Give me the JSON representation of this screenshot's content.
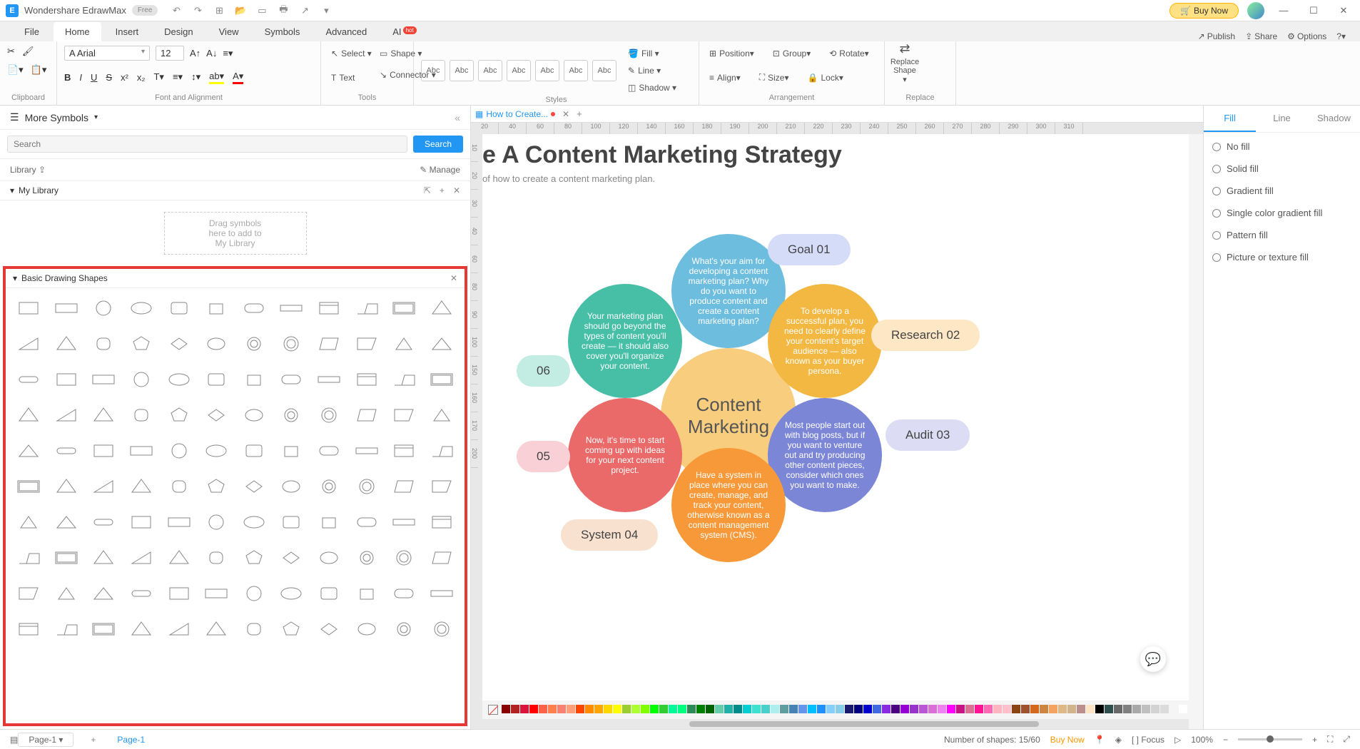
{
  "app": {
    "name": "Wondershare EdrawMax",
    "badge": "Free"
  },
  "buy_now": "Buy Now",
  "menu": {
    "file": "File",
    "home": "Home",
    "insert": "Insert",
    "design": "Design",
    "view": "View",
    "symbols": "Symbols",
    "advanced": "Advanced",
    "ai": "AI",
    "hot": "hot",
    "publish": "Publish",
    "share": "Share",
    "options": "Options"
  },
  "ribbon": {
    "clipboard": "Clipboard",
    "font_align": "Font and Alignment",
    "tools": "Tools",
    "styles": "Styles",
    "arrangement": "Arrangement",
    "replace_g": "Replace",
    "font_name": "Arial",
    "font_size": "12",
    "select_btn": "Select ▾",
    "text_btn": "Text",
    "shape_btn": "Shape ▾",
    "connector_btn": "Connector ▾",
    "fill": "Fill ▾",
    "line": "Line ▾",
    "shadow": "Shadow ▾",
    "position": "Position▾",
    "align": "Align▾",
    "group": "Group▾",
    "size": "Size▾",
    "rotate": "Rotate▾",
    "lock": "Lock▾",
    "replace_shape": "Replace\nShape ▾",
    "abc": "Abc"
  },
  "left": {
    "more_symbols": "More Symbols",
    "search_ph": "Search",
    "search_btn": "Search",
    "library": "Library",
    "manage": "Manage",
    "my_library": "My Library",
    "drag_hint": "Drag symbols\nhere to add to\nMy Library",
    "basic_shapes": "Basic Drawing Shapes"
  },
  "doc": {
    "tab1": "How to Create...",
    "title_frag": "e A Content Marketing Strategy",
    "subtitle": "of how to create a content marketing plan.",
    "center": "Content Marketing",
    "b1": "What's your aim for developing a content marketing plan? Why do you want to produce content and create a content marketing plan?",
    "b2": "To develop a successful plan, you need to clearly define your content's target audience — also known as your buyer persona.",
    "b3": "Most people start out with blog posts, but if you want to venture out and try producing other content pieces, consider which ones you want to make.",
    "b4": "Have a system in place where you can create, manage, and track your content, otherwise known as a content management system (CMS).",
    "b5": "Now, it's time to start coming up with ideas for your next content project.",
    "b6": "Your marketing plan should go beyond the types of content you'll create — it should also cover you'll organize your content.",
    "l1": "Goal 01",
    "l2": "Research 02",
    "l3": "Audit 03",
    "l4": "System 04",
    "l5": "05",
    "l6": "06"
  },
  "right_panel": {
    "fill_tab": "Fill",
    "line_tab": "Line",
    "shadow_tab": "Shadow",
    "no_fill": "No fill",
    "solid": "Solid fill",
    "gradient": "Gradient fill",
    "single_grad": "Single color gradient fill",
    "pattern": "Pattern fill",
    "picture": "Picture or texture fill"
  },
  "status": {
    "page_sel": "Page-1",
    "active_page": "Page-1",
    "shapes": "Number of shapes: 15/60",
    "buy": "Buy Now",
    "focus": "Focus",
    "zoom": "100%"
  },
  "ruler_marks": [
    "20",
    "40",
    "60",
    "80",
    "100",
    "120",
    "140",
    "160",
    "180",
    "190",
    "200",
    "210",
    "220",
    "230",
    "240",
    "250",
    "260",
    "270",
    "280",
    "290",
    "300",
    "310"
  ],
  "ruler_v_marks": [
    "10",
    "20",
    "30",
    "40",
    "60",
    "80",
    "90",
    "100",
    "150",
    "160",
    "170",
    "200"
  ],
  "palette": [
    "#8b0000",
    "#b22222",
    "#dc143c",
    "#ff0000",
    "#ff6347",
    "#ff7f50",
    "#fa8072",
    "#ffa07a",
    "#ff4500",
    "#ff8c00",
    "#ffa500",
    "#ffd700",
    "#ffff00",
    "#9acd32",
    "#adff2f",
    "#7fff00",
    "#00ff00",
    "#32cd32",
    "#00fa9a",
    "#00ff7f",
    "#2e8b57",
    "#008000",
    "#006400",
    "#66cdaa",
    "#20b2aa",
    "#008b8b",
    "#00ced1",
    "#40e0d0",
    "#48d1cc",
    "#afeeee",
    "#5f9ea0",
    "#4682b4",
    "#6495ed",
    "#00bfff",
    "#1e90ff",
    "#87cefa",
    "#87ceeb",
    "#191970",
    "#000080",
    "#0000cd",
    "#4169e1",
    "#8a2be2",
    "#4b0082",
    "#9400d3",
    "#9932cc",
    "#ba55d3",
    "#da70d6",
    "#ee82ee",
    "#ff00ff",
    "#c71585",
    "#db7093",
    "#ff1493",
    "#ff69b4",
    "#ffb6c1",
    "#ffc0cb",
    "#8b4513",
    "#a0522d",
    "#d2691e",
    "#cd853f",
    "#f4a460",
    "#deb887",
    "#d2b48c",
    "#bc8f8f",
    "#ffe4c4",
    "#000000",
    "#2f4f4f",
    "#696969",
    "#808080",
    "#a9a9a9",
    "#c0c0c0",
    "#d3d3d3",
    "#dcdcdc",
    "#f5f5f5",
    "#ffffff"
  ]
}
